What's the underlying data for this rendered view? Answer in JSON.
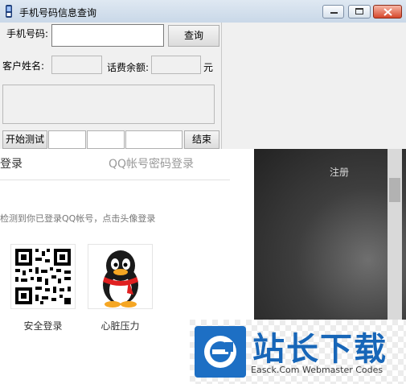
{
  "window": {
    "title": "手机号码信息查询",
    "minimize": "–",
    "maximize": "□",
    "close": "✕"
  },
  "form": {
    "phone_label": "手机号码:",
    "phone_value": "",
    "query_button": "查询",
    "name_label": "客户姓名:",
    "name_value": "",
    "balance_label": "话费余额:",
    "balance_value": "",
    "balance_unit": "元",
    "start_button": "开始测试",
    "end_button": "结束"
  },
  "web": {
    "title": "登录",
    "tab": "QQ帐号密码登录",
    "hint": "检测到你已登录QQ帐号，点击头像登录",
    "tiles": [
      {
        "label": "安全登录",
        "icon": "qr-code-icon"
      },
      {
        "label": "心脏压力",
        "icon": "qq-penguin-avatar"
      }
    ],
    "register_link": "注册"
  },
  "watermark": {
    "brand": "站长下载",
    "url_text": "Easck.Com Webmaster Codes"
  }
}
